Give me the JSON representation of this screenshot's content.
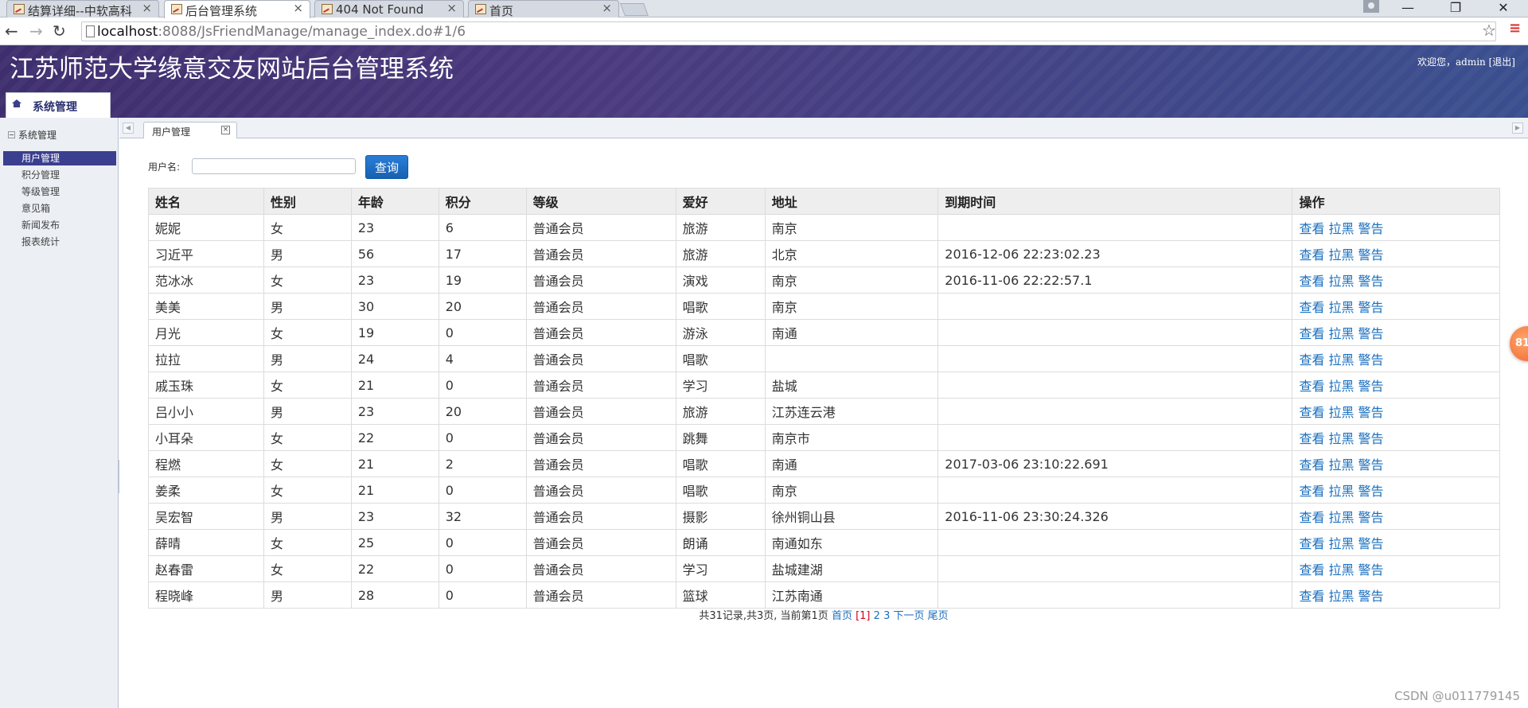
{
  "browser": {
    "tabs": [
      {
        "title": "结算详细--中软高科"
      },
      {
        "title": "后台管理系统"
      },
      {
        "title": "404 Not Found"
      },
      {
        "title": "首页"
      }
    ],
    "url_host": "localhost",
    "url_rest": ":8088/JsFriendManage/manage_index.do#1/6"
  },
  "header": {
    "title": "江苏师范大学缘意交友网站后台管理系统",
    "welcome": "欢迎您，admin",
    "logout": "[退出]",
    "top_tab": "系统管理"
  },
  "sidebar": {
    "heading": "系统管理",
    "items": [
      {
        "label": "用户管理"
      },
      {
        "label": "积分管理"
      },
      {
        "label": "等级管理"
      },
      {
        "label": "意见箱"
      },
      {
        "label": "新闻发布"
      },
      {
        "label": "报表统计"
      }
    ]
  },
  "content_tab": {
    "label": "用户管理",
    "close": "×"
  },
  "search": {
    "label": "用户名:",
    "value": "",
    "button": "查询"
  },
  "table": {
    "headers": [
      "姓名",
      "性别",
      "年龄",
      "积分",
      "等级",
      "爱好",
      "地址",
      "到期时间",
      "操作"
    ],
    "rows": [
      [
        "妮妮",
        "女",
        "23",
        "6",
        "普通会员",
        "旅游",
        "南京",
        ""
      ],
      [
        "习近平",
        "男",
        "56",
        "17",
        "普通会员",
        "旅游",
        "北京",
        "2016-12-06 22:23:02.23"
      ],
      [
        "范冰冰",
        "女",
        "23",
        "19",
        "普通会员",
        "演戏",
        "南京",
        "2016-11-06 22:22:57.1"
      ],
      [
        "美美",
        "男",
        "30",
        "20",
        "普通会员",
        "唱歌",
        "南京",
        ""
      ],
      [
        "月光",
        "女",
        "19",
        "0",
        "普通会员",
        "游泳",
        "南通",
        ""
      ],
      [
        "拉拉",
        "男",
        "24",
        "4",
        "普通会员",
        "唱歌",
        "",
        ""
      ],
      [
        "戚玉珠",
        "女",
        "21",
        "0",
        "普通会员",
        "学习",
        "盐城",
        ""
      ],
      [
        "吕小小",
        "男",
        "23",
        "20",
        "普通会员",
        "旅游",
        "江苏连云港",
        ""
      ],
      [
        "小耳朵",
        "女",
        "22",
        "0",
        "普通会员",
        "跳舞",
        "南京市",
        ""
      ],
      [
        "程燃",
        "女",
        "21",
        "2",
        "普通会员",
        "唱歌",
        "南通",
        "2017-03-06 23:10:22.691"
      ],
      [
        "姜柔",
        "女",
        "21",
        "0",
        "普通会员",
        "唱歌",
        "南京",
        ""
      ],
      [
        "吴宏智",
        "男",
        "23",
        "32",
        "普通会员",
        "摄影",
        "徐州铜山县",
        "2016-11-06 23:30:24.326"
      ],
      [
        "薛晴",
        "女",
        "25",
        "0",
        "普通会员",
        "朗诵",
        "南通如东",
        ""
      ],
      [
        "赵春雷",
        "女",
        "22",
        "0",
        "普通会员",
        "学习",
        "盐城建湖",
        ""
      ],
      [
        "程晓峰",
        "男",
        "28",
        "0",
        "普通会员",
        "篮球",
        "江苏南通",
        ""
      ]
    ],
    "ops": [
      "查看",
      "拉黑",
      "警告"
    ]
  },
  "pager": {
    "summary": "共31记录,共3页, 当前第1页",
    "first": "首页",
    "current": "[1]",
    "page2": "2",
    "page3": "3",
    "next": "下一页",
    "last": "尾页"
  },
  "float_badge": "81",
  "watermark": "CSDN @u011779145"
}
